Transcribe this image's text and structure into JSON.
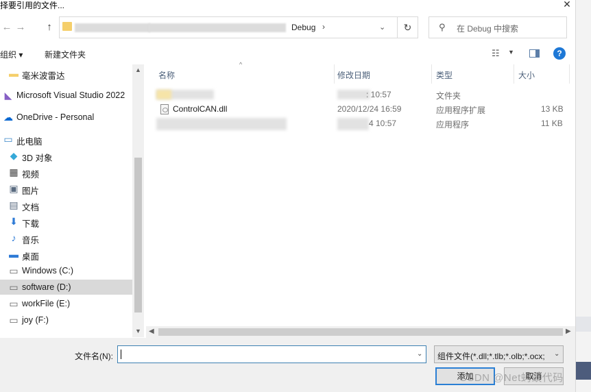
{
  "window": {
    "title": "择要引用的文件...",
    "close_glyph": "✕"
  },
  "navigation": {
    "back_glyph": "←",
    "forward_glyph": "→",
    "up_glyph": "↑",
    "address": {
      "current": "Debug",
      "separator": "›",
      "dropdown_glyph": "⌄"
    },
    "refresh_glyph": "↻",
    "search": {
      "icon": "search-icon",
      "glyph": "⚲",
      "placeholder": "在 Debug 中搜索"
    }
  },
  "toolbar": {
    "organize_label": "组织 ▾",
    "new_folder_label": "新建文件夹",
    "view_glyph": "☷",
    "view_dropdown_glyph": "▼",
    "help_glyph": "?"
  },
  "sidebar": {
    "items": [
      {
        "label": "毫米波雷达",
        "icon": "folder-icon",
        "glyph": "▬",
        "color": "#f5cf6b"
      },
      {
        "label": "Microsoft Visual Studio 2022",
        "icon": "visual-studio-icon",
        "glyph": "◣",
        "color": "#865fc5"
      },
      {
        "label": "OneDrive - Personal",
        "icon": "cloud-icon",
        "glyph": "☁",
        "color": "#0a68d1"
      },
      {
        "label": "此电脑",
        "icon": "computer-icon",
        "glyph": "▭",
        "color": "#3a86c8"
      },
      {
        "label": "3D 对象",
        "icon": "cube-icon",
        "glyph": "◆",
        "color": "#36a9d8"
      },
      {
        "label": "视频",
        "icon": "video-icon",
        "glyph": "▦",
        "color": "#444444"
      },
      {
        "label": "图片",
        "icon": "picture-icon",
        "glyph": "▣",
        "color": "#5a6b80"
      },
      {
        "label": "文档",
        "icon": "document-icon",
        "glyph": "▤",
        "color": "#5a6b80"
      },
      {
        "label": "下载",
        "icon": "download-icon",
        "glyph": "⬇",
        "color": "#2f7bd6"
      },
      {
        "label": "音乐",
        "icon": "music-icon",
        "glyph": "♪",
        "color": "#2f7bd6"
      },
      {
        "label": "桌面",
        "icon": "desktop-icon",
        "glyph": "▬",
        "color": "#2f7bd6"
      },
      {
        "label": "Windows (C:)",
        "icon": "drive-icon",
        "glyph": "▭",
        "color": "#666666"
      },
      {
        "label": "software (D:)",
        "icon": "drive-icon",
        "glyph": "▭",
        "color": "#666666",
        "selected": true
      },
      {
        "label": "workFile (E:)",
        "icon": "drive-icon",
        "glyph": "▭",
        "color": "#666666"
      },
      {
        "label": "joy (F:)",
        "icon": "drive-icon",
        "glyph": "▭",
        "color": "#666666"
      }
    ],
    "scroll_up_glyph": "▲",
    "scroll_down_glyph": "▼"
  },
  "file_list": {
    "columns": [
      "名称",
      "修改日期",
      "类型",
      "大小"
    ],
    "sort_glyph": "^",
    "rows": [
      {
        "name": "",
        "date": ": 10:57",
        "type": "文件夹",
        "size": ""
      },
      {
        "name": "ControlCAN.dll",
        "date": "2020/12/24 16:59",
        "type": "应用程序扩展",
        "size": "13 KB"
      },
      {
        "name": "",
        "date": "4 10:57",
        "type": "应用程序",
        "size": "11 KB"
      }
    ],
    "hscroll_left_glyph": "◀",
    "hscroll_right_glyph": "▶"
  },
  "footer": {
    "filename_label": "文件名(N):",
    "filename_value": "",
    "filename_dropdown_glyph": "⌄",
    "filetype_value": "组件文件(*.dll;*.tlb;*.olb;*.ocx;",
    "filetype_dropdown_glyph": "⌄",
    "add_button": "添加",
    "cancel_button": "取消",
    "watermark": "CSDN @Net蚂蚁代码"
  },
  "colors": {
    "accent": "#2a7fd4",
    "selected_bg": "#d9d9d9",
    "header_text": "#4c607a"
  }
}
